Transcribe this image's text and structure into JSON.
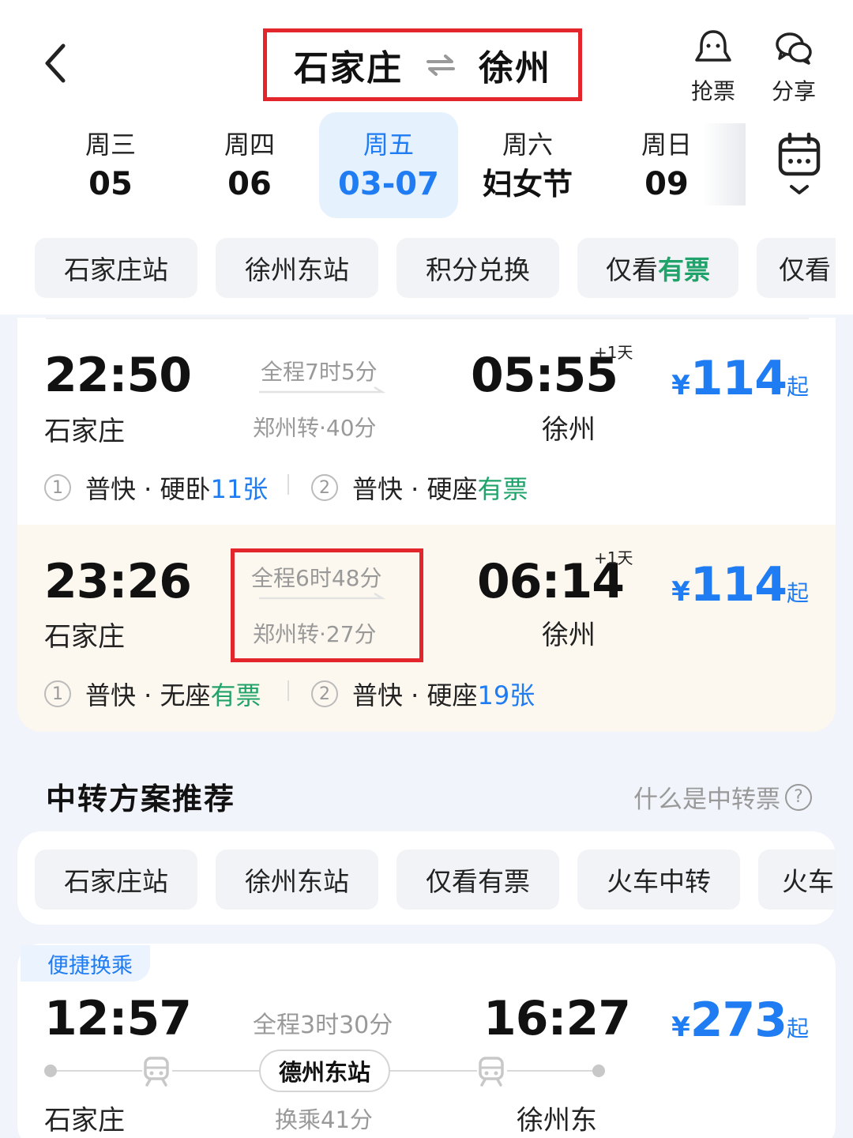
{
  "header": {
    "from_city": "石家庄",
    "to_city": "徐州",
    "actions": [
      {
        "label": "抢票",
        "icon": "ghost-bell-icon"
      },
      {
        "label": "分享",
        "icon": "wechat-icon"
      }
    ]
  },
  "dates": [
    {
      "weekday": "周三",
      "day": "05"
    },
    {
      "weekday": "周四",
      "day": "06"
    },
    {
      "weekday": "周五",
      "day": "03-07",
      "selected": true
    },
    {
      "weekday": "周六",
      "day": "妇女节"
    },
    {
      "weekday": "周日",
      "day": "09"
    }
  ],
  "filters": [
    {
      "label": "石家庄站"
    },
    {
      "label": "徐州东站"
    },
    {
      "label": "积分兑换"
    },
    {
      "label_prefix": "仅看",
      "label_highlight": "有票"
    },
    {
      "label": "仅看"
    }
  ],
  "trains": [
    {
      "depart_time": "22:50",
      "depart_station": "石家庄",
      "duration": "全程7时5分",
      "transfer": "郑州转·40分",
      "arrive_time": "05:55",
      "arrive_station": "徐州",
      "next_day": "+1天",
      "price_symbol": "¥",
      "price": "114",
      "price_suffix": "起",
      "seg1": {
        "no": "1",
        "text": "普快 · 硬卧",
        "avail": "11张"
      },
      "seg2": {
        "no": "2",
        "text": "普快 · 硬座",
        "avail": "有票"
      }
    },
    {
      "depart_time": "23:26",
      "depart_station": "石家庄",
      "duration": "全程6时48分",
      "transfer": "郑州转·27分",
      "arrive_time": "06:14",
      "arrive_station": "徐州",
      "next_day": "+1天",
      "price_symbol": "¥",
      "price": "114",
      "price_suffix": "起",
      "seg1": {
        "no": "1",
        "text": "普快 · 无座",
        "avail": "有票"
      },
      "seg2": {
        "no": "2",
        "text": "普快 · 硬座",
        "avail": "19张"
      }
    }
  ],
  "transfer_section": {
    "title": "中转方案推荐",
    "help": "什么是中转票",
    "filters": [
      "石家庄站",
      "徐州东站",
      "仅看有票",
      "火车中转",
      "火车"
    ],
    "option": {
      "tag": "便捷换乘",
      "depart_time": "12:57",
      "depart_station": "石家庄",
      "duration": "全程3时30分",
      "hub_station": "德州东站",
      "transfer_wait": "换乘41分",
      "arrive_time": "16:27",
      "arrive_station": "徐州东",
      "price_symbol": "¥",
      "price": "273",
      "price_suffix": "起"
    }
  },
  "colors": {
    "accent_blue": "#1f7cf2",
    "available_green": "#1fa36a",
    "highlight_red": "#e3262c",
    "card_highlight_bg": "#fdf8ef"
  }
}
